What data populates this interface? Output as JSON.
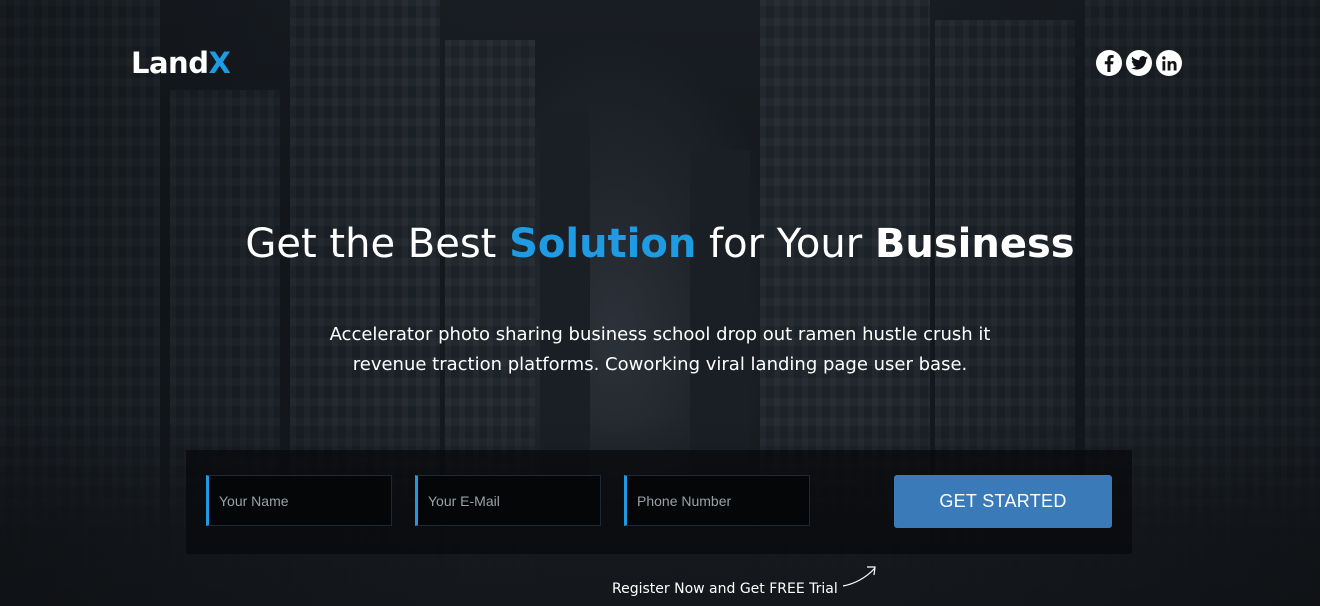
{
  "brand": {
    "logo_main": "Land",
    "logo_accent": "X",
    "accent_color": "#1e9be3"
  },
  "social": [
    {
      "icon": "facebook-icon",
      "glyph": "f"
    },
    {
      "icon": "twitter-icon",
      "glyph": "t"
    },
    {
      "icon": "linkedin-icon",
      "glyph": "in"
    }
  ],
  "hero": {
    "headline_part1": "Get the Best ",
    "headline_highlight": "Solution",
    "headline_part2": " for Your ",
    "headline_bold": "Business",
    "subtitle": "Accelerator photo sharing business school drop out ramen hustle crush it revenue traction platforms. Coworking viral landing page user base."
  },
  "form": {
    "name_placeholder": "Your Name",
    "email_placeholder": "Your E-Mail",
    "phone_placeholder": "Phone Number",
    "submit_label": "GET STARTED",
    "button_color": "#3a7ab8"
  },
  "footer": {
    "trial_text": "Register Now and Get FREE Trial"
  }
}
